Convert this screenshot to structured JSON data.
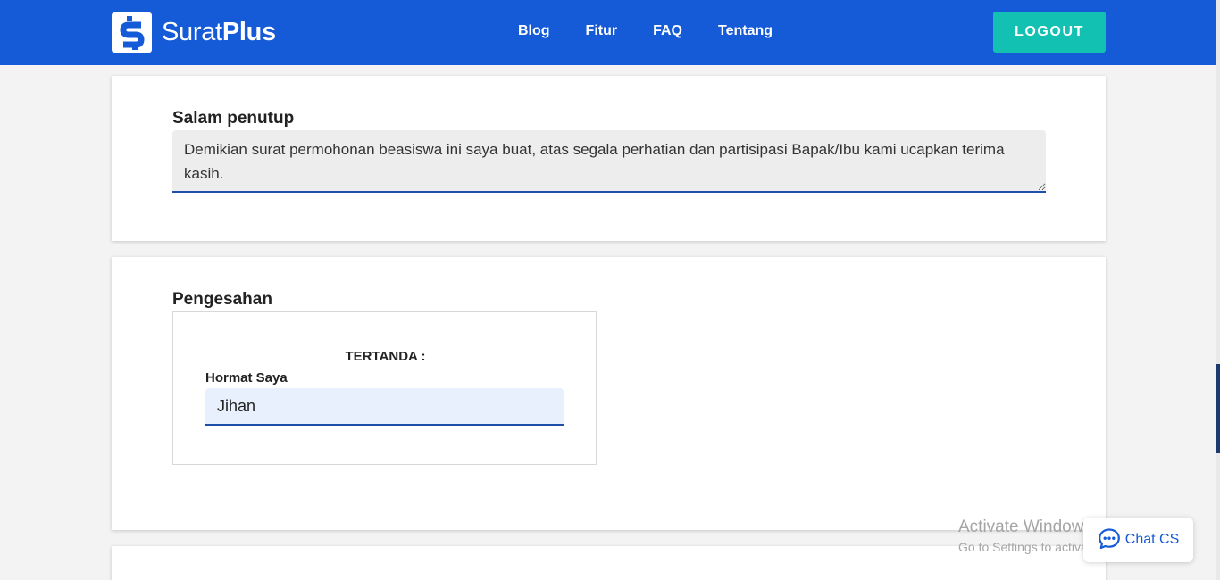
{
  "colors": {
    "brand": "#155ad6",
    "accent": "#12c1b1",
    "input_underline": "#1e4fa8"
  },
  "header": {
    "logo_light": "Surat",
    "logo_bold": "Plus",
    "logo_icon": "s-logo-icon",
    "nav": [
      {
        "label": "Blog"
      },
      {
        "label": "Fitur"
      },
      {
        "label": "FAQ"
      },
      {
        "label": "Tentang"
      }
    ],
    "logout_label": "LOGOUT"
  },
  "closing": {
    "title": "Salam penutup",
    "value": "Demikian surat permohonan beasiswa ini saya buat, atas segala perhatian dan partisipasi Bapak/Ibu kami ucapkan terima kasih."
  },
  "approval": {
    "title": "Pengesahan",
    "tertanda": "TERTANDA :",
    "hormat_label": "Hormat Saya",
    "name_value": "Jihan"
  },
  "watermark": {
    "title": "Activate Windows",
    "subtitle": "Go to Settings to activate Windows."
  },
  "chat": {
    "label": "Chat CS",
    "icon": "chat-bubble-icon"
  }
}
